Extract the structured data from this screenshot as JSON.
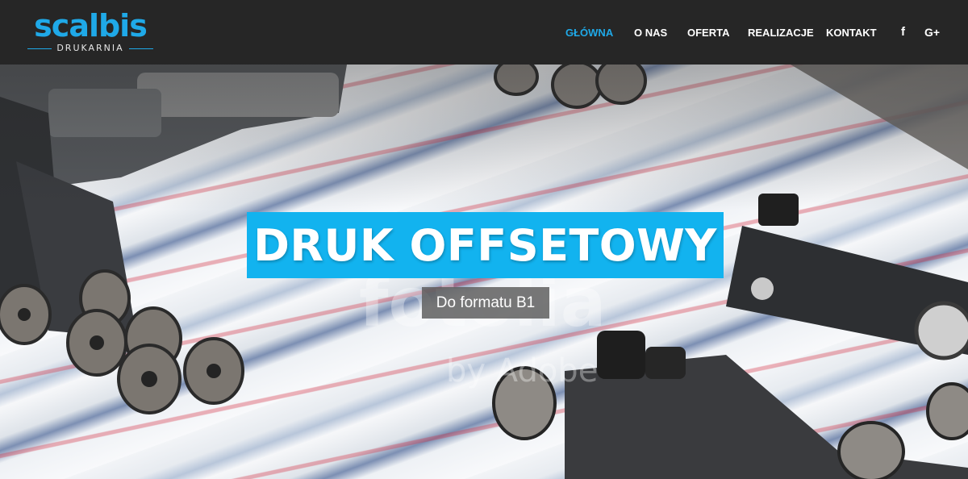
{
  "brand": {
    "name": "scalbis",
    "tagline": "DRUKARNIA",
    "accent_color": "#1fa9e8",
    "header_bg": "#262626"
  },
  "nav": {
    "items": [
      {
        "label": "GŁÓWNA",
        "active": true
      },
      {
        "label": "O NAS",
        "active": false
      },
      {
        "label": "OFERTA",
        "active": false
      },
      {
        "label": "REALIZACJE",
        "active": false
      },
      {
        "label": "KONTAKT",
        "active": false
      }
    ],
    "social": [
      {
        "icon": "facebook-icon",
        "glyph": "f"
      },
      {
        "icon": "google-plus-icon",
        "glyph": "G+"
      }
    ]
  },
  "hero": {
    "headline": "DRUK OFFSETOWY",
    "subheadline": "Do formatu B1",
    "headline_bg": "#12b3ef",
    "watermark": {
      "main": "fotolia",
      "sub": "by Adobe"
    }
  }
}
